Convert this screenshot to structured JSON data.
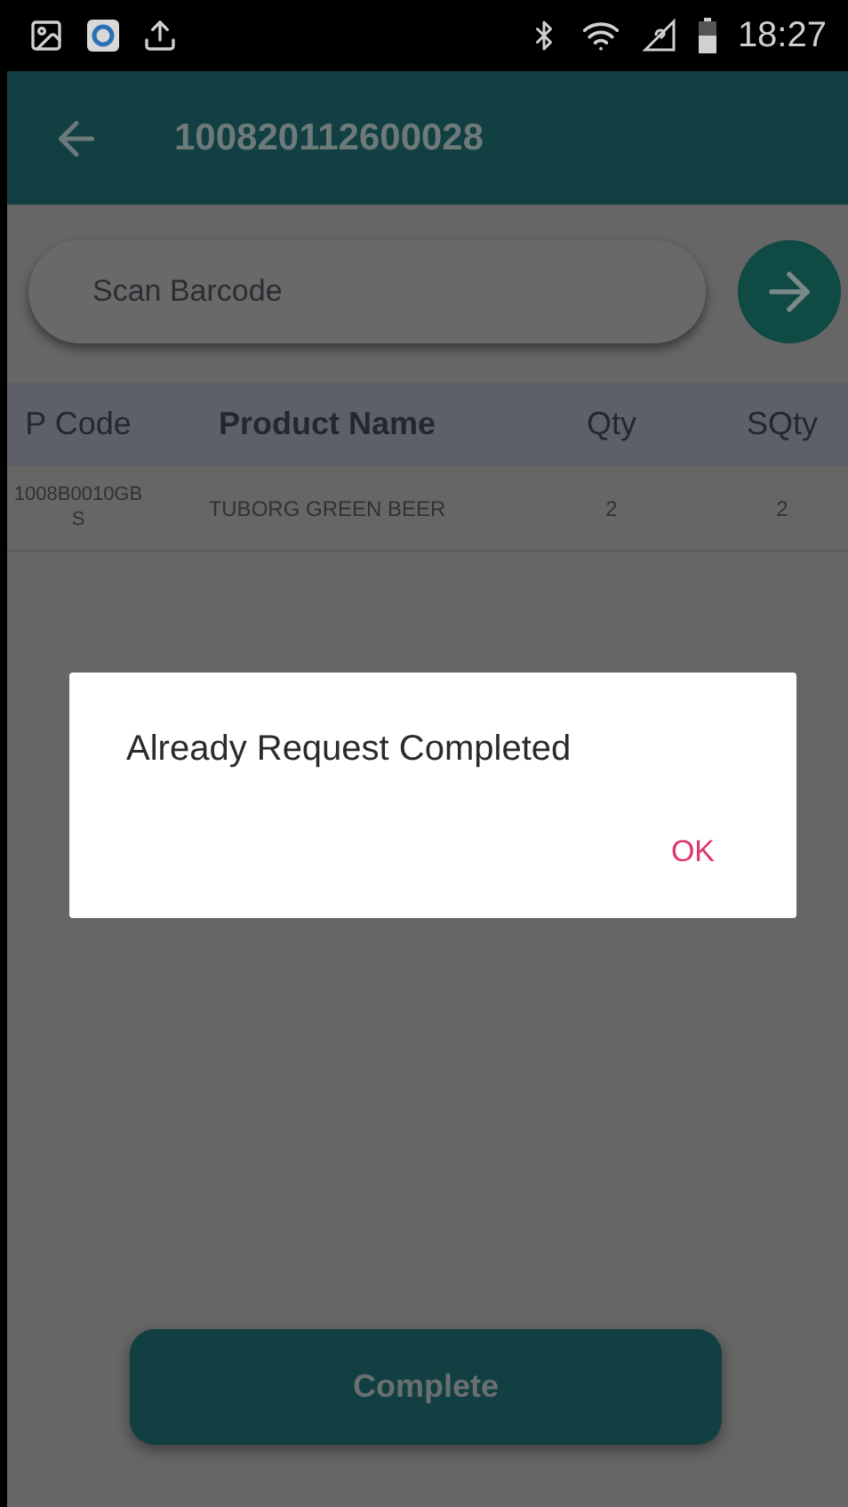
{
  "status_bar": {
    "time": "18:27"
  },
  "app_bar": {
    "title": "100820112600028"
  },
  "search": {
    "placeholder": "Scan Barcode"
  },
  "table": {
    "columns": [
      "P Code",
      "Product Name",
      "Qty",
      "SQty"
    ],
    "rows": [
      [
        "1008B0010GB S",
        "TUBORG GREEN BEER",
        "2",
        "2"
      ]
    ]
  },
  "dialog": {
    "message": "Already Request Completed",
    "button": "OK"
  },
  "complete_button": "Complete"
}
